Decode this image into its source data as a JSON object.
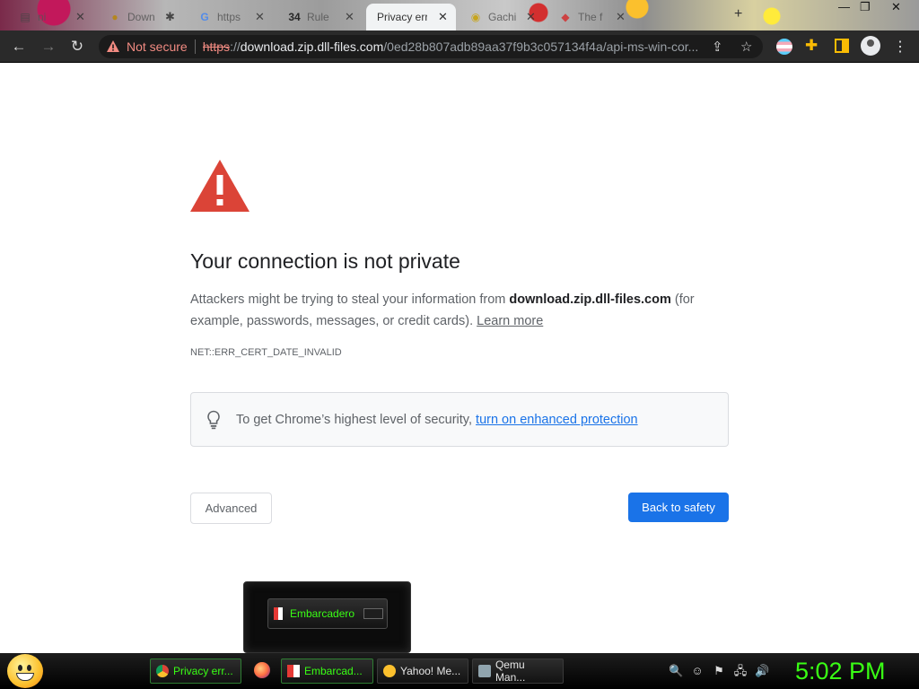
{
  "tabs": [
    {
      "title": "ni"
    },
    {
      "title": "Down"
    },
    {
      "title": "https"
    },
    {
      "title": "Rule"
    },
    {
      "title": "Privacy error",
      "active": true
    },
    {
      "title": "Gachi"
    },
    {
      "title": "The f"
    }
  ],
  "tab_close_glyph": "✕",
  "new_tab_glyph": "+",
  "window_controls": {
    "minimize": "—",
    "restore": "❐",
    "close": "✕"
  },
  "toolbar": {
    "back_glyph": "←",
    "forward_glyph": "→",
    "reload_glyph": "↻",
    "not_secure_label": "Not secure",
    "url_scheme": "https",
    "url_sep": "://",
    "url_host": "download.zip.dll-files.com",
    "url_path": "/0ed28b807adb89aa37f9b3c057134f4a/api-ms-win-cor...",
    "share_glyph": "⇪",
    "bookmark_glyph": "☆",
    "extensions_glyph": "✚",
    "menu_glyph": "⋮"
  },
  "interstitial": {
    "heading": "Your connection is not private",
    "explanation_prefix": "Attackers might be trying to steal your information from ",
    "explanation_host": "download.zip.dll-files.com",
    "explanation_suffix": " (for example, passwords, messages, or credit cards). ",
    "learn_more": "Learn more",
    "error_code": "NET::ERR_CERT_DATE_INVALID",
    "enhanced_prefix": "To get Chrome’s highest level of security, ",
    "enhanced_link": "turn on enhanced protection",
    "advanced_button": "Advanced",
    "back_button": "Back to safety",
    "alert_color": "#db4437",
    "primary_color": "#1a73e8"
  },
  "taskbar_preview": {
    "label": "Embarcadero"
  },
  "taskbar": {
    "tasks": [
      {
        "label": "Privacy err..."
      },
      {
        "label": "Embarcad..."
      },
      {
        "label": "Yahoo! Me..."
      },
      {
        "label": "Qemu Man..."
      }
    ],
    "tray": {
      "search": "🔍",
      "tray1": "☺",
      "flag": "⚑",
      "network": "🖧",
      "volume": "🔊"
    },
    "clock": "5:02 PM",
    "accent_color": "#39ff14"
  }
}
